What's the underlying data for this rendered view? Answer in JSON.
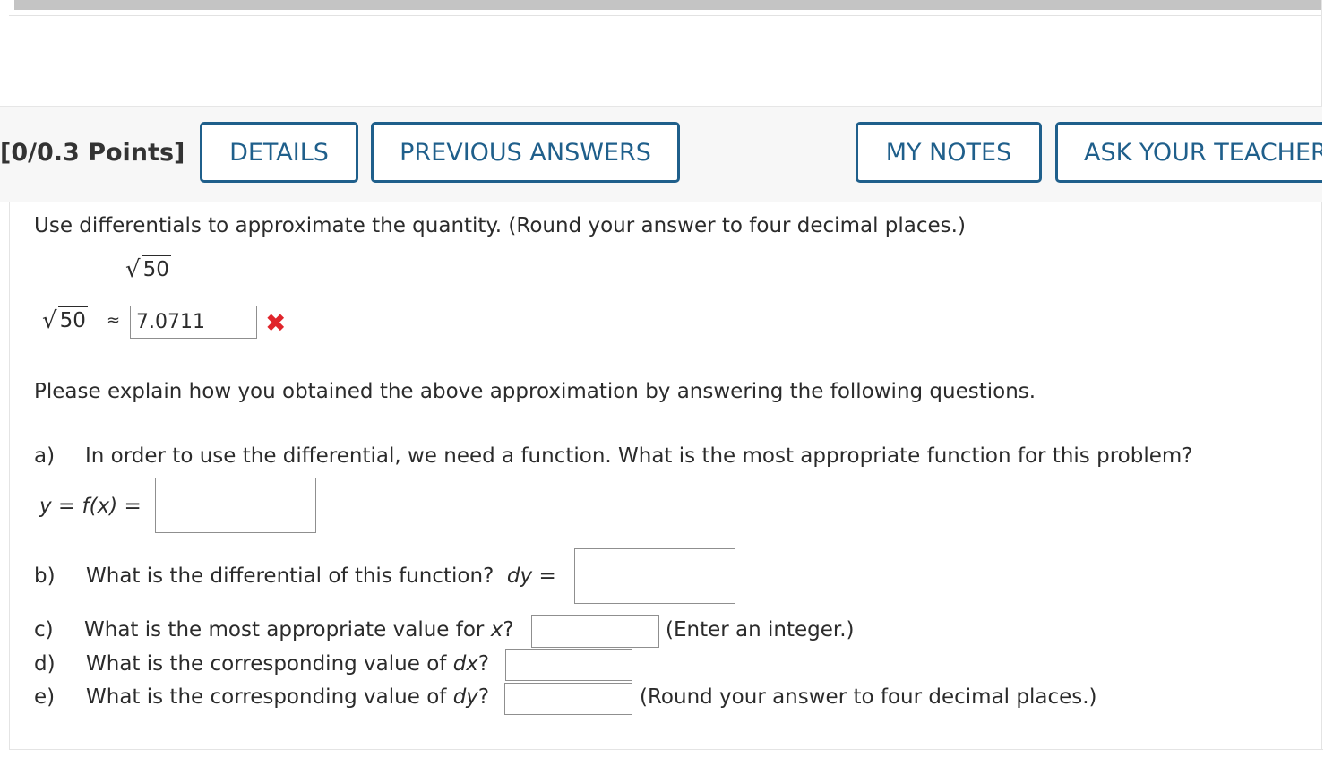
{
  "header": {
    "points": "[0/0.3 Points]",
    "details_label": "DETAILS",
    "previous_answers_label": "PREVIOUS ANSWERS",
    "my_notes_label": "MY NOTES",
    "ask_teacher_label": "ASK YOUR TEACHER",
    "accent_color": "#1f5f8b"
  },
  "question": {
    "instruction": "Use differentials to approximate the quantity. (Round your answer to four decimal places.)",
    "quantity_radicand": "50",
    "answer_radicand": "50",
    "approx_symbol": "≈",
    "answer_value": "7.0711",
    "answer_status_icon": "incorrect-x-icon",
    "explain_prompt": "Please explain how you obtained the above approximation by answering the following questions.",
    "parts": {
      "a": {
        "letter": "a)",
        "text": "In order to use the differential, we need a function. What is the most appropriate function for this problem?",
        "lhs_y": "y",
        "lhs_eq": "=",
        "lhs_f": "f",
        "lhs_x": "(x)",
        "rhs_eq": "=",
        "value": ""
      },
      "b": {
        "letter": "b)",
        "text": "What is the differential of this function?",
        "var": "dy",
        "eq": "=",
        "value": ""
      },
      "c": {
        "letter": "c)",
        "text": "What is the most appropriate value for",
        "var": "x",
        "q": "?",
        "hint": "(Enter an integer.)",
        "value": ""
      },
      "d": {
        "letter": "d)",
        "text": "What is the corresponding value of",
        "var": "dx",
        "q": "?",
        "value": ""
      },
      "e": {
        "letter": "e)",
        "text": "What is the corresponding value of",
        "var": "dy",
        "q": "?",
        "hint": "(Round your answer to four decimal places.)",
        "value": ""
      }
    }
  }
}
